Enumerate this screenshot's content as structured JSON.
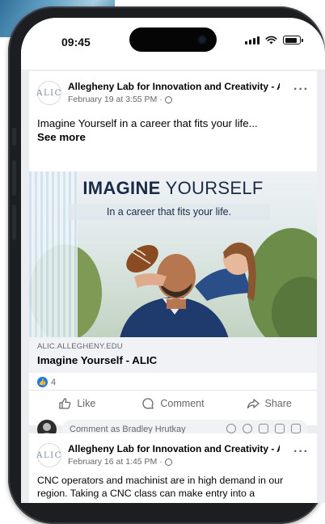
{
  "status_bar": {
    "time": "09:45"
  },
  "post1": {
    "avatar_text": "ALIC",
    "page_name": "Allegheny Lab for Innovation and Creativity - A...",
    "date": "February 19 at 3:55 PM ·",
    "text": "Imagine Yourself in a career that fits your life...",
    "see_more": "See more",
    "media": {
      "headline_bold": "IMAGINE",
      "headline_light": " YOURSELF",
      "subheadline": "In a career that fits your life."
    },
    "link": {
      "domain": "ALIC.ALLEGHENY.EDU",
      "title": "Imagine Yourself - ALIC"
    },
    "reaction_count": "4",
    "actions": {
      "like": "Like",
      "comment": "Comment",
      "share": "Share"
    },
    "comment_placeholder": "Comment as Bradley Hrutkay"
  },
  "post2": {
    "avatar_text": "ALIC",
    "page_name": "Allegheny Lab for Innovation and Creativity - A...",
    "date": "February 16 at 1:45 PM ·",
    "text": "CNC operators and machinist are in high demand in our region. Taking a CNC class can make entry into a"
  },
  "colors": {
    "accent": "#1877f2",
    "feed_bg": "#ebedf0",
    "headline": "#1b2a47"
  }
}
